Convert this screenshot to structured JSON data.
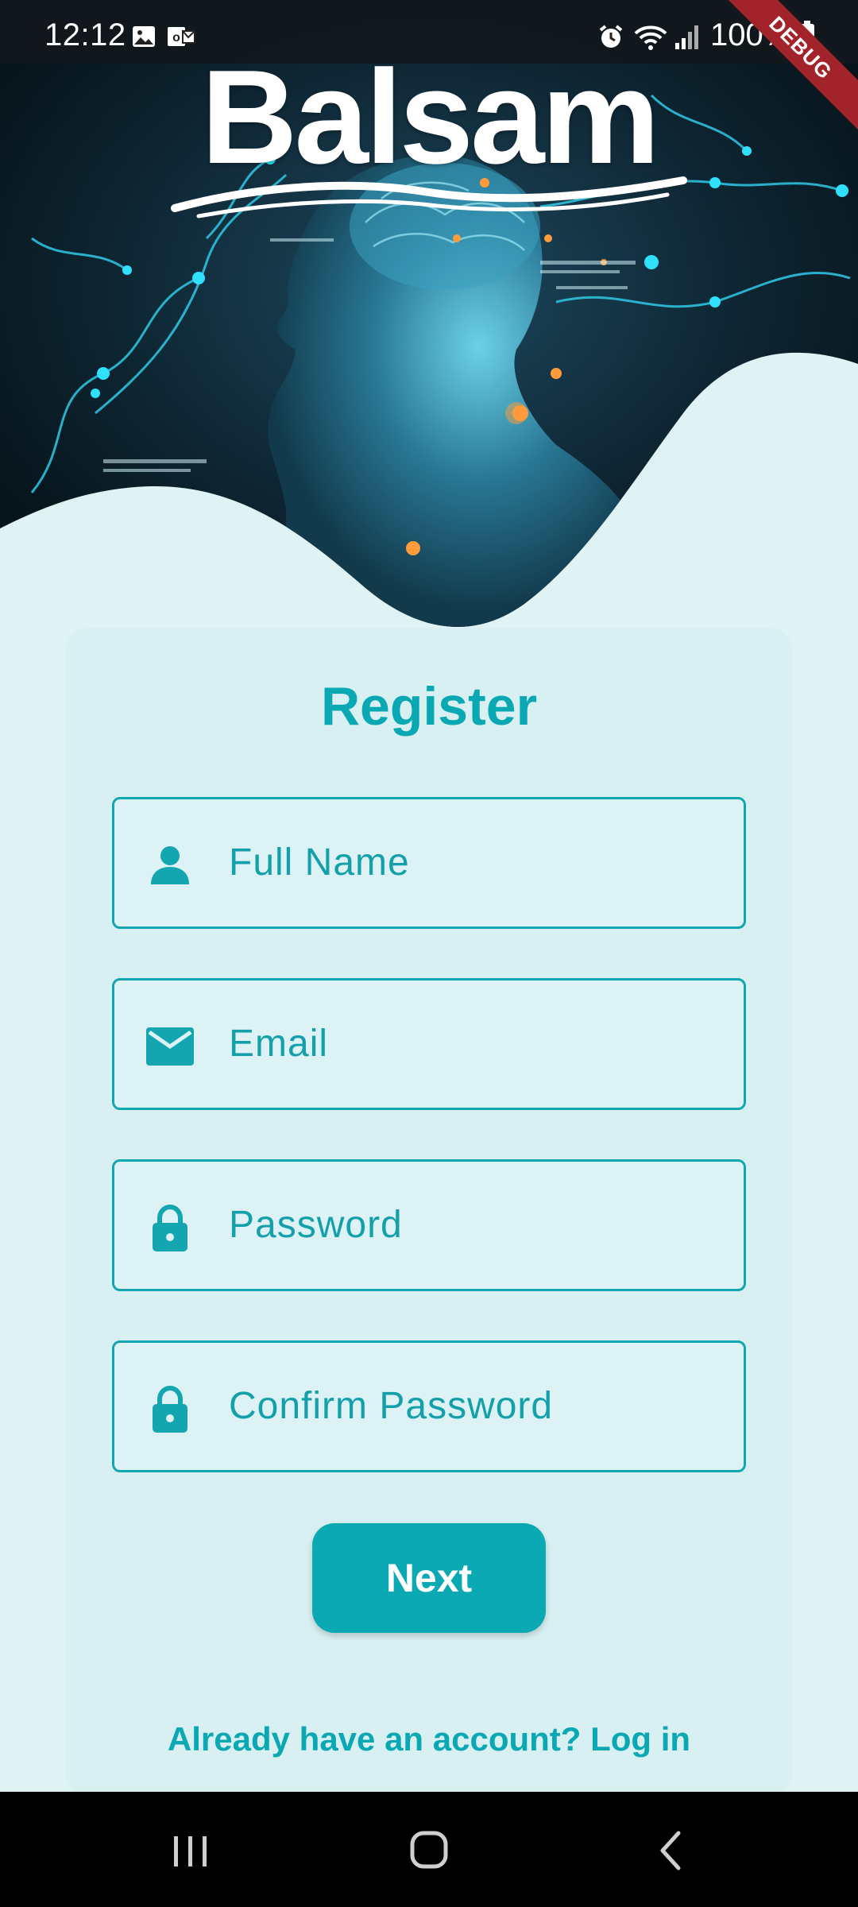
{
  "status_bar": {
    "time": "12:12",
    "battery": "100%",
    "debug_banner": "DEBUG",
    "icons": [
      "gallery-icon",
      "outlook-icon",
      "alarm-icon",
      "wifi-icon",
      "signal-icon",
      "battery-icon"
    ]
  },
  "logo": {
    "text": "Balsam"
  },
  "form": {
    "title": "Register",
    "fields": [
      {
        "label": "Full Name",
        "icon": "person-icon"
      },
      {
        "label": "Email",
        "icon": "mail-icon"
      },
      {
        "label": "Password",
        "icon": "lock-icon"
      },
      {
        "label": "Confirm Password",
        "icon": "lock-icon"
      }
    ],
    "next_label": "Next",
    "login_link": "Already have an account? Log in"
  },
  "nav": {
    "icons": [
      "recent-apps-icon",
      "home-icon",
      "back-icon"
    ]
  },
  "colors": {
    "accent": "#0aa9b3",
    "background": "#dff3f4",
    "hero_dark": "#0b1d27"
  }
}
